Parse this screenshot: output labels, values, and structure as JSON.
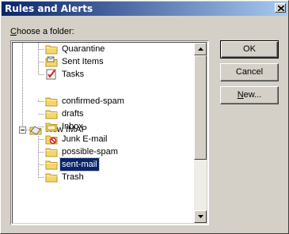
{
  "window": {
    "title": "Rules and Alerts"
  },
  "dialog": {
    "prompt_prefix": "",
    "prompt_underlined": "C",
    "prompt_rest": "hoose a folder:"
  },
  "tree": {
    "items": [
      {
        "label": "Quarantine",
        "icon": "folder-icon"
      },
      {
        "label": "Sent Items",
        "icon": "sent-items-folder-icon"
      },
      {
        "label": "Tasks",
        "icon": "tasks-icon"
      },
      {
        "label": "New IMAP",
        "icon": "mailbox-root-icon",
        "expanded": true
      },
      {
        "label": "confirmed-spam",
        "icon": "folder-icon"
      },
      {
        "label": "drafts",
        "icon": "folder-icon"
      },
      {
        "label": "Inbox",
        "icon": "inbox-folder-icon"
      },
      {
        "label": "Junk E-mail",
        "icon": "junk-folder-icon"
      },
      {
        "label": "possible-spam",
        "icon": "folder-icon"
      },
      {
        "label": "sent-mail",
        "icon": "folder-icon",
        "selected": true
      },
      {
        "label": "Trash",
        "icon": "folder-icon"
      }
    ]
  },
  "buttons": {
    "ok": "OK",
    "cancel": "Cancel",
    "new_underlined": "N",
    "new_rest": "ew..."
  },
  "colors": {
    "titlebar_start": "#0a246a",
    "titlebar_end": "#a6caf0",
    "selection": "#0a246a",
    "folder": "#f6d66a"
  }
}
